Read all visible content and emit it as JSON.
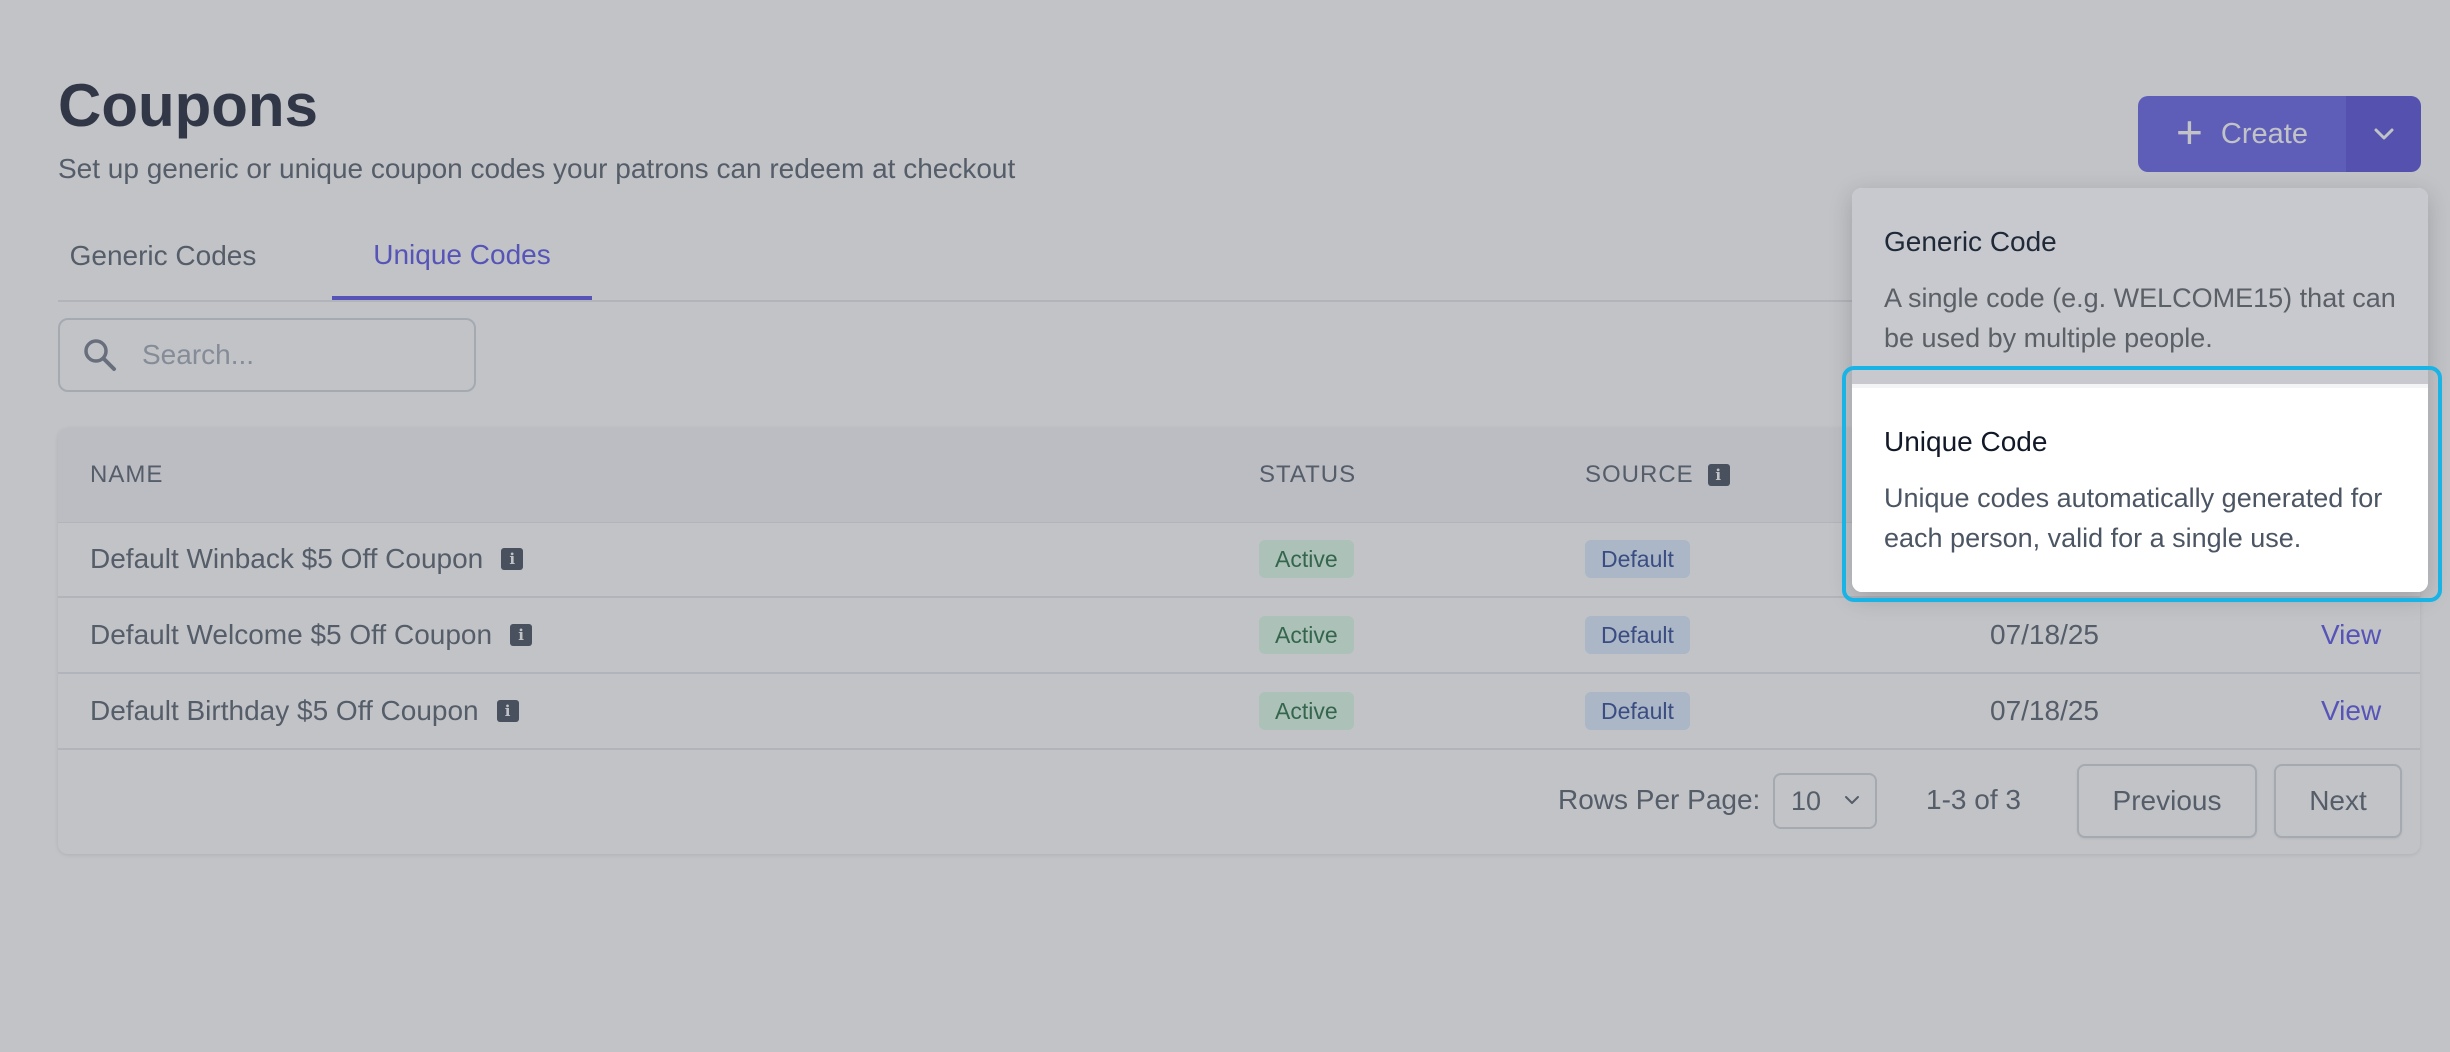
{
  "header": {
    "title": "Coupons",
    "subtitle": "Set up generic or unique coupon codes your patrons can redeem at checkout",
    "create_label": "Create"
  },
  "tabs": [
    {
      "label": "Generic Codes",
      "active": false
    },
    {
      "label": "Unique Codes",
      "active": true
    }
  ],
  "search": {
    "placeholder": "Search..."
  },
  "table": {
    "columns": [
      "NAME",
      "STATUS",
      "SOURCE",
      "",
      ""
    ],
    "rows": [
      {
        "name": "Default Winback $5 Off Coupon",
        "status": "Active",
        "source": "Default",
        "date": "",
        "action": ""
      },
      {
        "name": "Default Welcome $5 Off Coupon",
        "status": "Active",
        "source": "Default",
        "date": "07/18/25",
        "action": "View"
      },
      {
        "name": "Default Birthday $5 Off Coupon",
        "status": "Active",
        "source": "Default",
        "date": "07/18/25",
        "action": "View"
      }
    ]
  },
  "pagination": {
    "rows_per_page_label": "Rows Per Page:",
    "rows_per_page_value": "10",
    "range": "1-3 of 3",
    "previous_label": "Previous",
    "next_label": "Next"
  },
  "create_menu": {
    "items": [
      {
        "title": "Generic Code",
        "description": "A single code (e.g. WELCOME15) that can be used by multiple people."
      },
      {
        "title": "Unique Code",
        "description": "Unique codes automatically generated for each person, valid for a single use."
      }
    ]
  },
  "colors": {
    "accent": "#4f46e5",
    "create_button": "#5b57e8",
    "active_badge_bg": "#dcfce7",
    "default_badge_bg": "#dbeafe",
    "highlight": "#19b3e6"
  }
}
